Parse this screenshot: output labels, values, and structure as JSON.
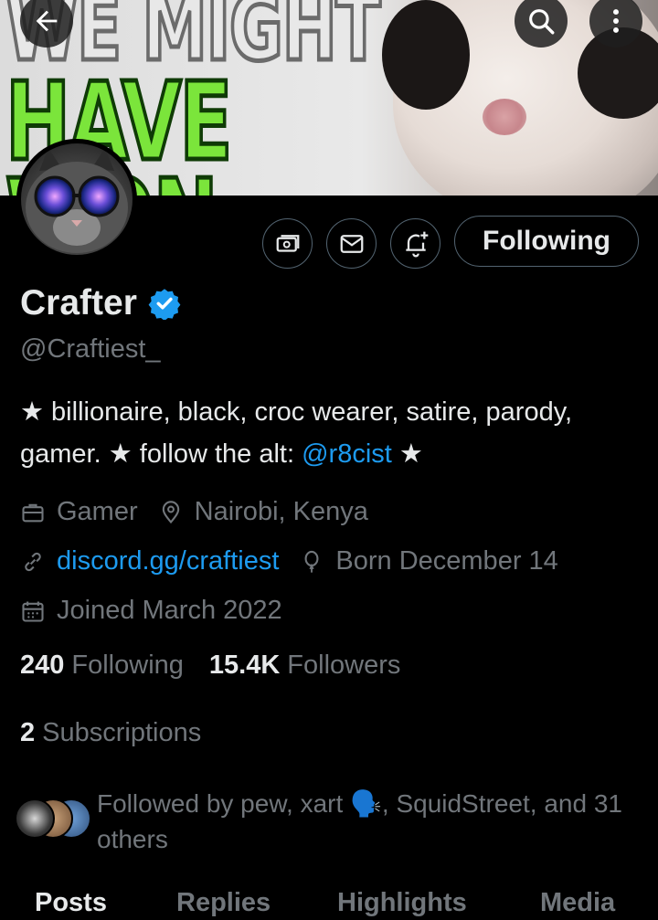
{
  "banner": {
    "line1": "WE MIGHT",
    "line2": "HAVE WON.."
  },
  "header": {
    "back_icon": "arrow-left-icon",
    "search_icon": "search-icon",
    "more_icon": "more-vertical-icon"
  },
  "actions": {
    "subscribe_icon": "money-icon",
    "message_icon": "envelope-icon",
    "notify_icon": "bell-plus-icon",
    "following_label": "Following"
  },
  "profile": {
    "name": "Crafter",
    "handle": "@Craftiest_",
    "bio_part1": "★ billionaire, black, croc wearer, satire, parody, gamer. ★ follow the alt: ",
    "bio_link": "@r8cist",
    "bio_part2": " ★",
    "category": "Gamer",
    "location": "Nairobi, Kenya",
    "website": "discord.gg/craftiest",
    "birthday": "Born December 14",
    "joined": "Joined March 2022"
  },
  "stats": {
    "following_count": "240",
    "following_label": "Following",
    "followers_count": "15.4K",
    "followers_label": "Followers",
    "subscriptions_count": "2",
    "subscriptions_label": "Subscriptions"
  },
  "followed_by": {
    "text": "Followed by pew, xart 🗣️, SquidStreet, and 31 others"
  },
  "tabs": [
    {
      "label": "Posts"
    },
    {
      "label": "Replies"
    },
    {
      "label": "Highlights"
    },
    {
      "label": "Media"
    }
  ],
  "colors": {
    "accent": "#1d9bf0",
    "secondary_text": "#71767b",
    "background": "#000000"
  }
}
